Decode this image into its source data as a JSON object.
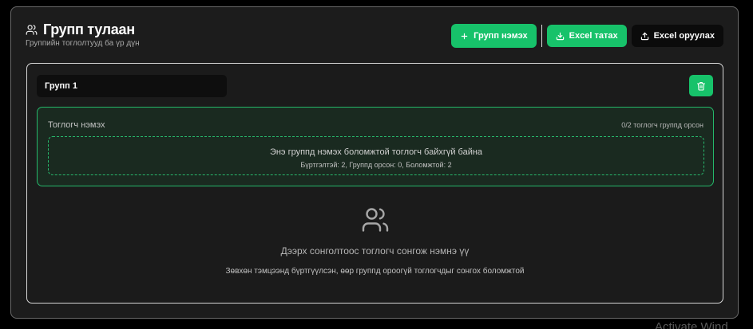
{
  "header": {
    "title": "Групп тулаан",
    "subtitle": "Группийн тоглолтууд ба үр дүн",
    "icon": "users-icon"
  },
  "actions": {
    "add_group": "Групп нэмэх",
    "excel_download": "Excel татах",
    "excel_upload": "Excel оруулах"
  },
  "group": {
    "name": "Групп 1",
    "add_player": {
      "title": "Тоглогч нэмэх",
      "count": "0/2 тоглогч группд орсон",
      "empty_message": "Энэ группд нэмэх боломжтой тоглогч байхгүй байна",
      "stats": "Бүртгэлтэй: 2, Группд орсон: 0, Боломжтой: 2"
    },
    "placeholder": {
      "main": "Дээрх сонголтоос тоглогч сонгож нэмнэ үү",
      "sub": "Зөвхөн тэмцээнд бүртгүүлсэн, өөр группд ороогүй тоглогчдыг сонгох боломжтой"
    }
  },
  "watermark": "Activate Wind",
  "colors": {
    "accent": "#17c26a",
    "panel_bg": "#1a2a20",
    "card_bg": "#1c1c1c"
  }
}
